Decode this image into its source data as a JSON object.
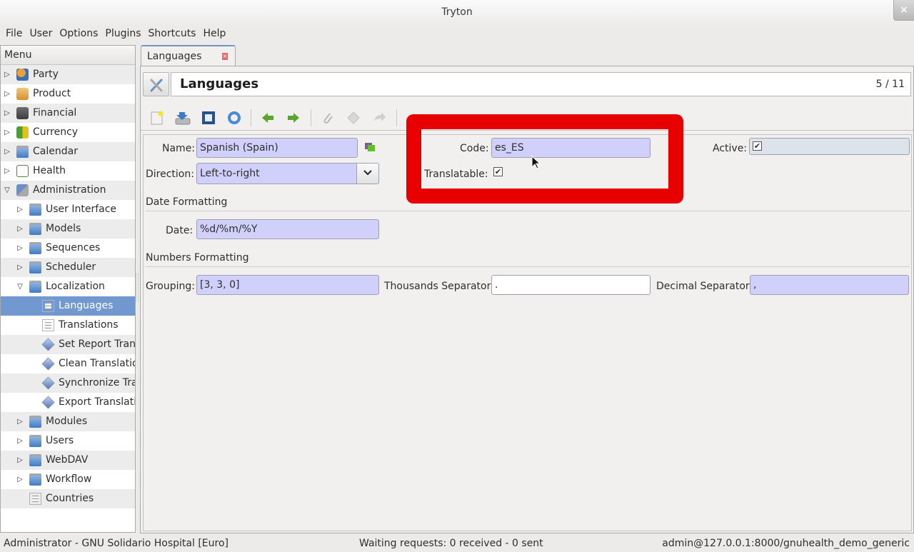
{
  "window": {
    "title": "Tryton",
    "close_glyph": "×"
  },
  "menubar": [
    "File",
    "User",
    "Options",
    "Plugins",
    "Shortcuts",
    "Help"
  ],
  "sidebar": {
    "header": "Menu",
    "items": [
      {
        "label": "Party",
        "level": 0,
        "expander": "collapsed",
        "icon": "party-icon"
      },
      {
        "label": "Product",
        "level": 0,
        "expander": "collapsed",
        "icon": "product-icon"
      },
      {
        "label": "Financial",
        "level": 0,
        "expander": "collapsed",
        "icon": "calculator-icon"
      },
      {
        "label": "Currency",
        "level": 0,
        "expander": "collapsed",
        "icon": "currency-icon"
      },
      {
        "label": "Calendar",
        "level": 0,
        "expander": "collapsed",
        "icon": "folder-icon"
      },
      {
        "label": "Health",
        "level": 0,
        "expander": "collapsed",
        "icon": "health-icon"
      },
      {
        "label": "Administration",
        "level": 0,
        "expander": "expanded",
        "icon": "tools-icon"
      },
      {
        "label": "User Interface",
        "level": 1,
        "expander": "collapsed",
        "icon": "folder-icon"
      },
      {
        "label": "Models",
        "level": 1,
        "expander": "collapsed",
        "icon": "folder-icon"
      },
      {
        "label": "Sequences",
        "level": 1,
        "expander": "collapsed",
        "icon": "folder-icon"
      },
      {
        "label": "Scheduler",
        "level": 1,
        "expander": "collapsed",
        "icon": "folder-icon"
      },
      {
        "label": "Localization",
        "level": 1,
        "expander": "expanded",
        "icon": "folder-icon"
      },
      {
        "label": "Languages",
        "level": 2,
        "expander": "none",
        "icon": "document-icon",
        "selected": true
      },
      {
        "label": "Translations",
        "level": 2,
        "expander": "none",
        "icon": "document-icon"
      },
      {
        "label": "Set Report Tran",
        "level": 2,
        "expander": "none",
        "icon": "wizard-icon"
      },
      {
        "label": "Clean Translatio",
        "level": 2,
        "expander": "none",
        "icon": "wizard-icon"
      },
      {
        "label": "Synchronize Tra",
        "level": 2,
        "expander": "none",
        "icon": "wizard-icon"
      },
      {
        "label": "Export Translati",
        "level": 2,
        "expander": "none",
        "icon": "wizard-icon"
      },
      {
        "label": "Modules",
        "level": 1,
        "expander": "collapsed",
        "icon": "folder-icon"
      },
      {
        "label": "Users",
        "level": 1,
        "expander": "collapsed",
        "icon": "folder-icon"
      },
      {
        "label": "WebDAV",
        "level": 1,
        "expander": "collapsed",
        "icon": "folder-icon"
      },
      {
        "label": "Workflow",
        "level": 1,
        "expander": "collapsed",
        "icon": "folder-icon"
      },
      {
        "label": "Countries",
        "level": 1,
        "expander": "none",
        "icon": "document-icon"
      }
    ]
  },
  "tab": {
    "label": "Languages",
    "close_glyph": "×"
  },
  "header": {
    "title": "Languages",
    "record_count": "5 / 11"
  },
  "toolbar": {
    "buttons": [
      "new-icon",
      "save-icon",
      "switch-view-icon",
      "reload-icon",
      "previous-icon",
      "next-icon",
      "attachment-icon",
      "action-icon",
      "relate-icon",
      "report-icon",
      "email-icon",
      "print-icon"
    ]
  },
  "form": {
    "name_label": "Name:",
    "name_value": "Spanish (Spain)",
    "code_label": "Code:",
    "code_value": "es_ES",
    "active_label": "Active:",
    "active_checked": true,
    "direction_label": "Direction:",
    "direction_value": "Left-to-right",
    "translatable_label": "Translatable:",
    "translatable_checked": true,
    "date_section": "Date Formatting",
    "date_label": "Date:",
    "date_value": "%d/%m/%Y",
    "numbers_section": "Numbers Formatting",
    "grouping_label": "Grouping:",
    "grouping_value": "[3, 3, 0]",
    "thousands_label": "Thousands Separator:",
    "thousands_value": ".",
    "decimal_label": "Decimal Separator:",
    "decimal_value": ",",
    "check_glyph": "✔"
  },
  "statusbar": {
    "left": "Administrator - GNU Solidario Hospital [Euro]",
    "center": "Waiting requests: 0 received - 0 sent",
    "right": "admin@127.0.0.1:8000/gnuhealth_demo_generic"
  },
  "colors": {
    "required_field": "#d0d0fb",
    "selection": "#7299cf",
    "annotation": "#e80000"
  }
}
